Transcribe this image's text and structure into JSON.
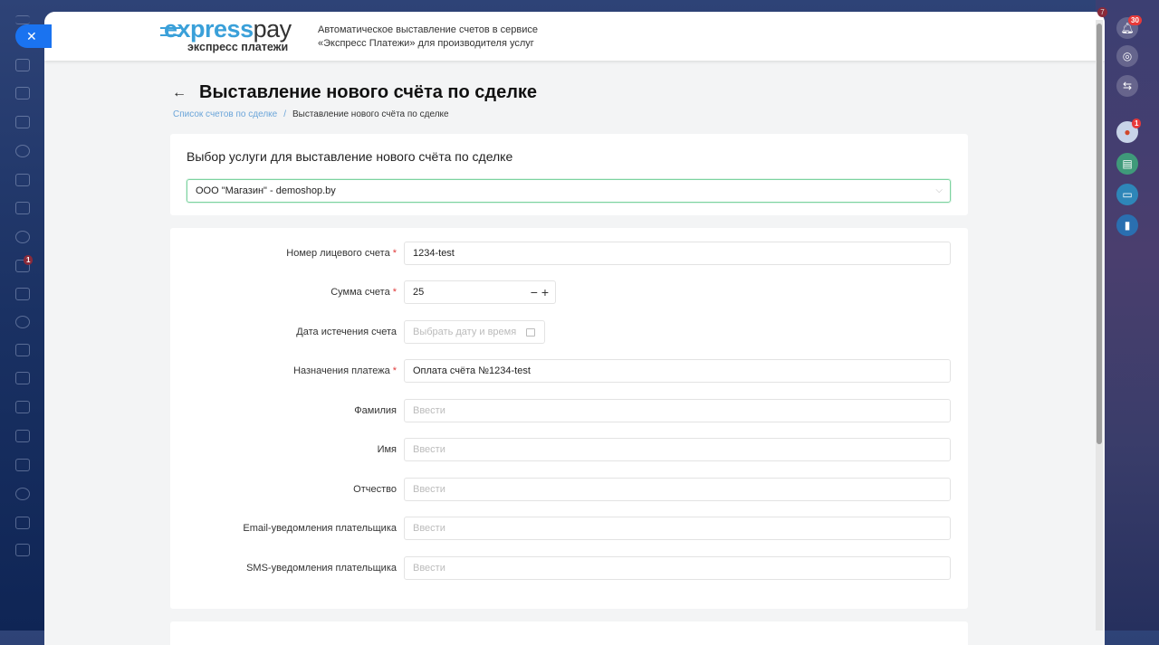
{
  "header": {
    "logo_main": "express",
    "logo_pay": "pay",
    "logo_sub": "экспресс платежи",
    "tagline_line1": "Автоматическое выставление счетов в сервисе",
    "tagline_line2": "«Экспресс Платежи» для производителя услуг"
  },
  "page": {
    "title": "Выставление нового счёта по сделке",
    "breadcrumb": [
      "Список счетов по сделке",
      "Выставление нового счёта по сделке"
    ],
    "breadcrumb_sep": "/"
  },
  "service_card": {
    "heading": "Выбор услуги для выставление нового счёта по сделке",
    "selected": "ООО \"Магазин\" - demoshop.by"
  },
  "form": {
    "fields": [
      {
        "label": "Номер лицевого счета",
        "required": true,
        "value": "1234-test",
        "placeholder": ""
      },
      {
        "label": "Сумма счета",
        "required": true,
        "value": "25",
        "placeholder": ""
      },
      {
        "label": "Дата истечения счета",
        "required": false,
        "value": "",
        "placeholder": "Выбрать дату и время"
      },
      {
        "label": "Назначения платежа",
        "required": true,
        "value": "Оплата счёта №1234-test",
        "placeholder": ""
      },
      {
        "label": "Фамилия",
        "required": false,
        "value": "",
        "placeholder": "Ввести"
      },
      {
        "label": "Имя",
        "required": false,
        "value": "",
        "placeholder": "Ввести"
      },
      {
        "label": "Отчество",
        "required": false,
        "value": "",
        "placeholder": "Ввести"
      },
      {
        "label": "Email-уведомления плательщика",
        "required": false,
        "value": "",
        "placeholder": "Ввести"
      },
      {
        "label": "SMS-уведомления плательщика",
        "required": false,
        "value": "",
        "placeholder": "Ввести"
      }
    ],
    "required_mark": "*",
    "minus": "−",
    "plus": "+"
  },
  "right_panel": {
    "notifications_count": "30",
    "avatar_count": "1",
    "scroll_badge": "7"
  },
  "left_panel": {
    "chat_count": "1"
  },
  "colors": {
    "accent": "#1a73f0",
    "brand": "#3aa0d9",
    "select_border": "#7dd3a0",
    "required": "#e03a3a"
  }
}
